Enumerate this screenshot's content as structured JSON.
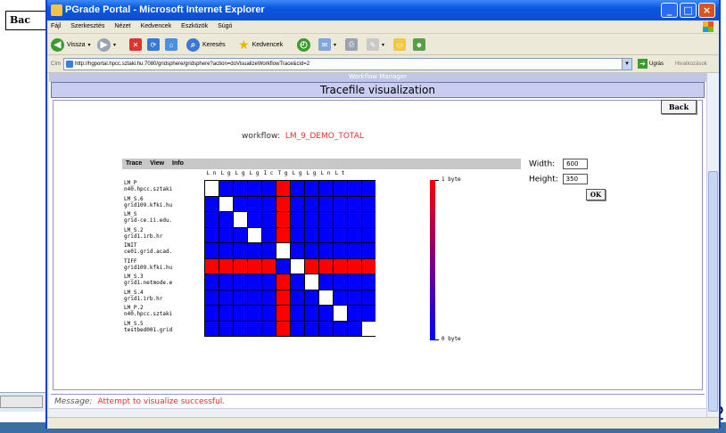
{
  "background": {
    "back_label": "Bac",
    "page_number_fragment": "2"
  },
  "window": {
    "title": "PGrade Portal - Microsoft Internet Explorer",
    "menu": [
      "Fájl",
      "Szerkesztés",
      "Nézet",
      "Kedvencek",
      "Eszközök",
      "Súgó"
    ],
    "toolbar": {
      "back_label": "Vissza",
      "search_label": "Keresés",
      "favorites_label": "Kedvencek"
    },
    "address": {
      "label": "Cím",
      "url": "http://hgportal.hpcc.sztaki.hu:7080/gridsphere/gridsphere?action=doVisualizeWorkflowTrace&cid=2",
      "go_label": "Ugrás",
      "links_label": "Hivatkozások"
    }
  },
  "page": {
    "top_strip": "Workflow Manager",
    "header": "Tracefile visualization",
    "back_button": "Back",
    "workflow_label": "workflow:",
    "workflow_name": "LM_9_DEMO_TOTAL",
    "vis_menu": [
      "Trace",
      "View",
      "Info"
    ],
    "column_labels": [
      "L n",
      "L g",
      "L g",
      "L g",
      "I c",
      "T g",
      "L g",
      "L g",
      "L n",
      "L t",
      "",
      ""
    ],
    "rows": [
      {
        "name": "LM_P",
        "host": "n40.hpcc.sztaki"
      },
      {
        "name": "LM_S.6",
        "host": "grid109.kfki.hu"
      },
      {
        "name": "LM_S",
        "host": "grid-ce.ii.edu."
      },
      {
        "name": "LM_S.2",
        "host": "grid1.irb.hr"
      },
      {
        "name": "INIT",
        "host": "ce01.grid.acad."
      },
      {
        "name": "TIFF",
        "host": "grid109.kfki.hu"
      },
      {
        "name": "LM_S.3",
        "host": "grid1.netmode.e"
      },
      {
        "name": "LM_S.4",
        "host": "grid1.irb.hr"
      },
      {
        "name": "LM_P.2",
        "host": "n40.hpcc.sztaki"
      },
      {
        "name": "LM_S.5",
        "host": "testbed001.grid"
      }
    ],
    "colorbar": {
      "max_label": "1 byte",
      "min_label": "0 byte",
      "max_color": "#ff0000",
      "min_color": "#0000ff"
    },
    "form": {
      "width_label": "Width:",
      "width_value": "600",
      "height_label": "Height:",
      "height_value": "350",
      "ok_label": "OK"
    },
    "message_label": "Message:",
    "message_text": "Attempt to visualize successful."
  },
  "chart_data": {
    "type": "heatmap",
    "rows": [
      "LM_P",
      "LM_S.6",
      "LM_S",
      "LM_S.2",
      "INIT",
      "TIFF",
      "LM_S.3",
      "LM_S.4",
      "LM_P.2",
      "LM_S.5"
    ],
    "columns": 12,
    "scale": [
      "0 byte",
      "1 byte"
    ],
    "values": [
      [
        -1,
        0,
        0,
        0,
        0,
        1,
        0,
        0,
        0,
        0,
        0,
        0
      ],
      [
        0,
        -1,
        0,
        0,
        0,
        1,
        0,
        0,
        0,
        0,
        0,
        0
      ],
      [
        0,
        0,
        -1,
        0,
        0,
        1,
        0,
        0,
        0,
        0,
        0,
        0
      ],
      [
        0,
        0,
        0,
        -1,
        0,
        1,
        0,
        0,
        0,
        0,
        0,
        0
      ],
      [
        0,
        0,
        0,
        0,
        0,
        -1,
        0,
        0,
        0,
        0,
        0,
        0
      ],
      [
        1,
        1,
        1,
        1,
        1,
        0,
        -1,
        1,
        1,
        1,
        1,
        1
      ],
      [
        0,
        0,
        0,
        0,
        0,
        1,
        0,
        -1,
        0,
        0,
        0,
        0
      ],
      [
        0,
        0,
        0,
        0,
        0,
        1,
        0,
        0,
        -1,
        0,
        0,
        0
      ],
      [
        0,
        0,
        0,
        0,
        0,
        1,
        0,
        0,
        0,
        -1,
        0,
        0
      ],
      [
        0,
        0,
        0,
        0,
        0,
        1,
        0,
        0,
        0,
        0,
        0,
        -1
      ]
    ],
    "colors": {
      "0": "#0000ff",
      "1": "#ff0000",
      "-1": "#ffffff"
    }
  }
}
